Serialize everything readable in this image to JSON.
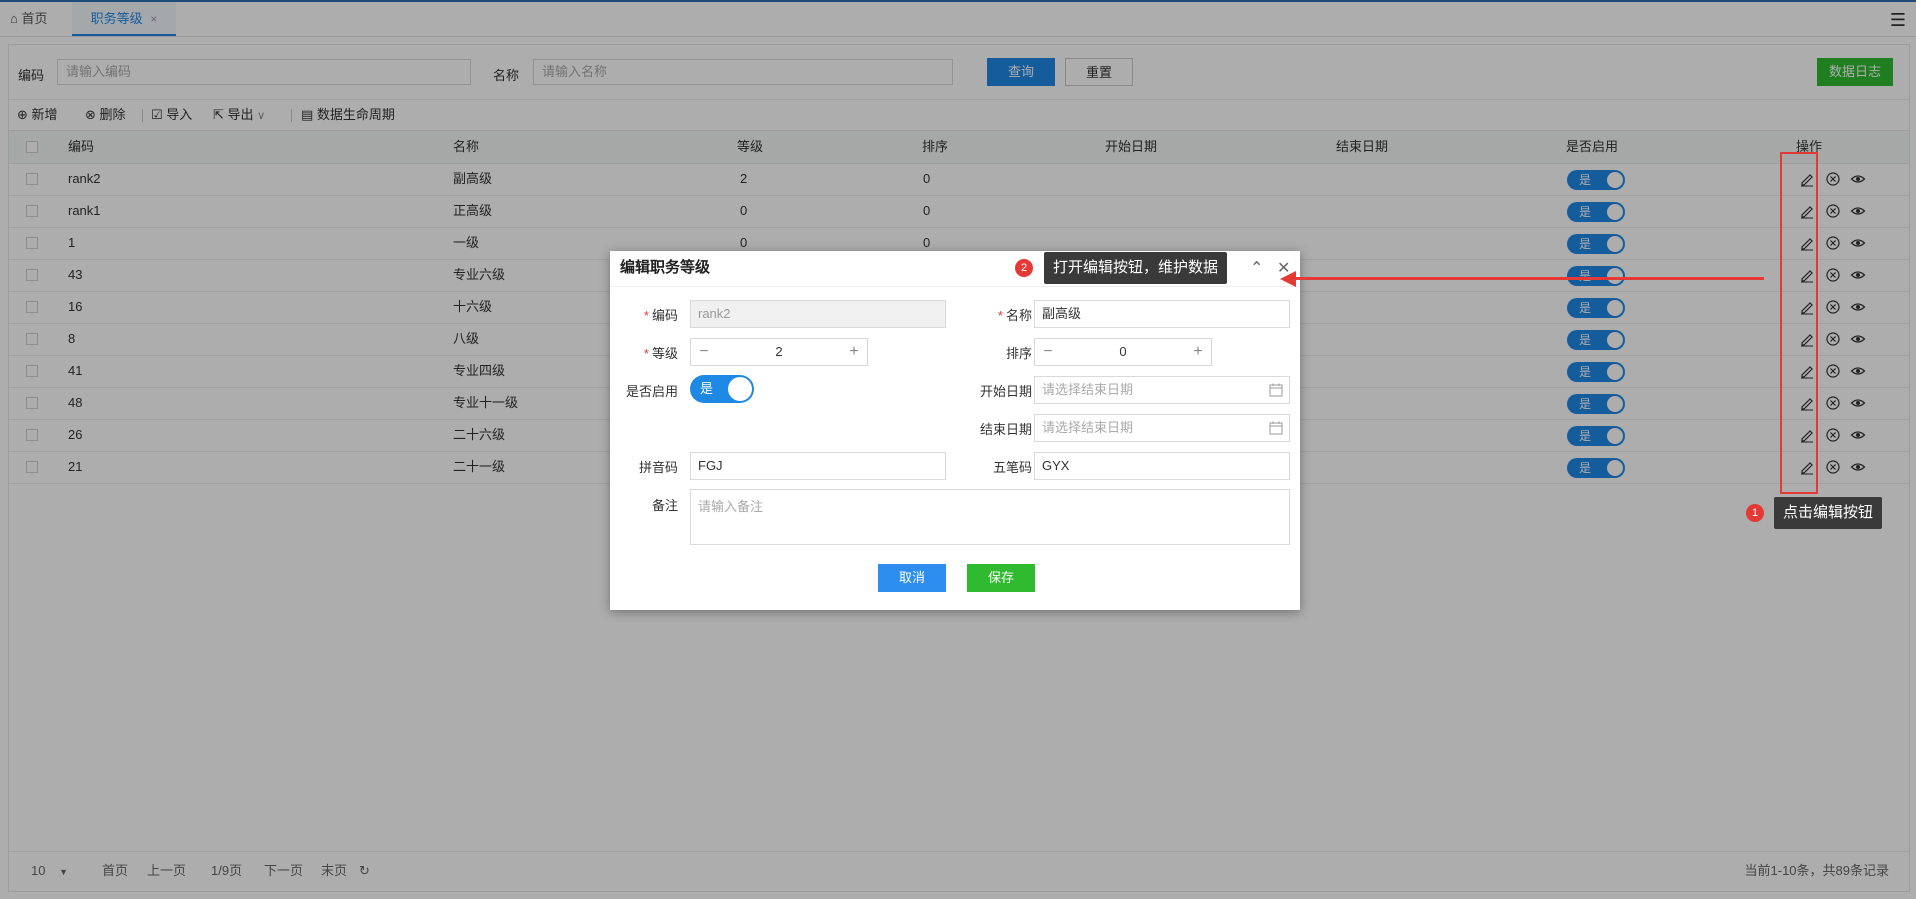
{
  "tabs": {
    "home": "首页",
    "active": "职务等级",
    "close": "×"
  },
  "search": {
    "code_label": "编码",
    "code_placeholder": "请输入编码",
    "name_label": "名称",
    "name_placeholder": "请输入名称",
    "query": "查询",
    "reset": "重置",
    "log": "数据日志"
  },
  "toolbar": {
    "add": "新增",
    "delete": "删除",
    "import": "导入",
    "export": "导出",
    "lifecycle": "数据生命周期"
  },
  "table": {
    "headers": {
      "code": "编码",
      "name": "名称",
      "level": "等级",
      "sort": "排序",
      "start": "开始日期",
      "end": "结束日期",
      "enabled": "是否启用",
      "ops": "操作"
    },
    "rows": [
      {
        "code": "rank2",
        "name": "副高级",
        "level": "2",
        "sort": "0",
        "enabled": "是"
      },
      {
        "code": "rank1",
        "name": "正高级",
        "level": "0",
        "sort": "0",
        "enabled": "是"
      },
      {
        "code": "1",
        "name": "一级",
        "level": "0",
        "sort": "0",
        "enabled": "是"
      },
      {
        "code": "43",
        "name": "专业六级",
        "level": "",
        "sort": "",
        "enabled": "是"
      },
      {
        "code": "16",
        "name": "十六级",
        "level": "",
        "sort": "",
        "enabled": "是"
      },
      {
        "code": "8",
        "name": "八级",
        "level": "",
        "sort": "",
        "enabled": "是"
      },
      {
        "code": "41",
        "name": "专业四级",
        "level": "",
        "sort": "",
        "enabled": "是"
      },
      {
        "code": "48",
        "name": "专业十一级",
        "level": "",
        "sort": "",
        "enabled": "是"
      },
      {
        "code": "26",
        "name": "二十六级",
        "level": "",
        "sort": "",
        "enabled": "是"
      },
      {
        "code": "21",
        "name": "二十一级",
        "level": "",
        "sort": "",
        "enabled": "是"
      }
    ]
  },
  "pager": {
    "size": "10",
    "first": "首页",
    "prev": "上一页",
    "page": "1/9页",
    "next": "下一页",
    "last": "末页",
    "summary": "当前1-10条，共89条记录"
  },
  "modal": {
    "title": "编辑职务等级",
    "code_label": "编码",
    "code_value": "rank2",
    "name_label": "名称",
    "name_value": "副高级",
    "level_label": "等级",
    "level_value": "2",
    "sort_label": "排序",
    "sort_value": "0",
    "enabled_label": "是否启用",
    "enabled_value": "是",
    "start_label": "开始日期",
    "start_placeholder": "请选择结束日期",
    "end_label": "结束日期",
    "end_placeholder": "请选择结束日期",
    "pinyin_label": "拼音码",
    "pinyin_value": "FGJ",
    "wubi_label": "五笔码",
    "wubi_value": "GYX",
    "remark_label": "备注",
    "remark_placeholder": "请输入备注",
    "cancel": "取消",
    "save": "保存"
  },
  "annotations": {
    "step1_num": "1",
    "step1_text": "点击编辑按钮",
    "step2_num": "2",
    "step2_text": "打开编辑按钮，维护数据"
  },
  "colors": {
    "primary": "#1e88e5",
    "success": "#2fba2f",
    "annotation": "#e53935"
  }
}
